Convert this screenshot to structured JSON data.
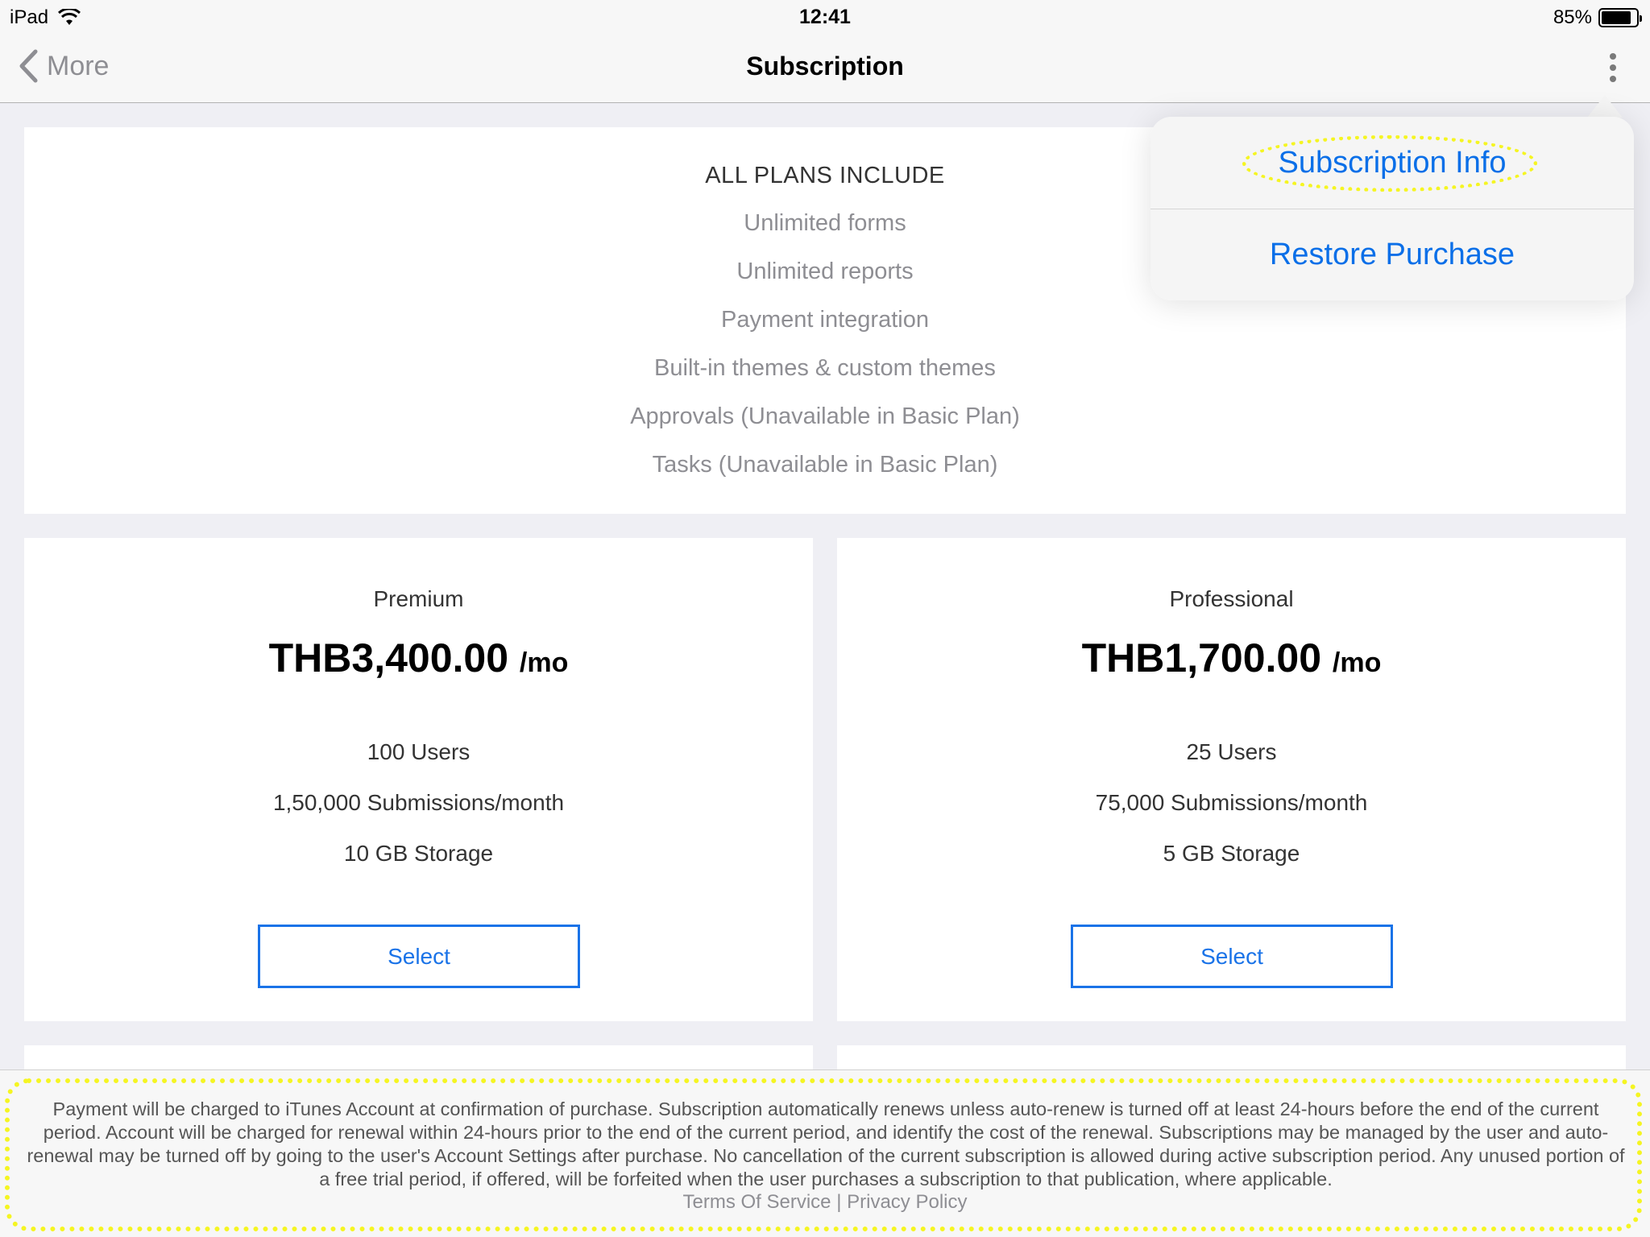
{
  "status_bar": {
    "device": "iPad",
    "time": "12:41",
    "battery": "85%",
    "battery_level": 0.85
  },
  "nav": {
    "back_label": "More",
    "title": "Subscription"
  },
  "popover": {
    "items": [
      "Subscription Info",
      "Restore Purchase"
    ]
  },
  "features": {
    "heading": "ALL PLANS INCLUDE",
    "items": [
      "Unlimited forms",
      "Unlimited reports",
      "Payment integration",
      "Built-in themes & custom themes",
      "Approvals (Unavailable in Basic Plan)",
      "Tasks (Unavailable in Basic Plan)"
    ]
  },
  "plans": [
    {
      "name": "Premium",
      "price": "THB3,400.00",
      "period": "/mo",
      "features": [
        "100 Users",
        "1,50,000 Submissions/month",
        "10 GB Storage"
      ],
      "button": "Select"
    },
    {
      "name": "Professional",
      "price": "THB1,700.00",
      "period": "/mo",
      "features": [
        "25 Users",
        "75,000 Submissions/month",
        "5 GB Storage"
      ],
      "button": "Select"
    }
  ],
  "footer": {
    "text": "Payment will be charged to iTunes Account at confirmation of purchase. Subscription automatically renews unless auto-renew is turned off at least 24-hours before the end of the current period. Account will be charged for renewal within 24-hours prior to the end of the current period, and identify the cost of the renewal. Subscriptions may be managed by the user and auto-renewal may be turned off by going to the user's Account Settings after purchase. No cancellation of the current subscription is allowed during active subscription period. Any unused portion of a free trial period, if offered, will be forfeited when the user purchases a subscription to that publication, where applicable.",
    "terms": "Terms Of Service",
    "separator": "|",
    "privacy": "Privacy Policy"
  },
  "colors": {
    "accent": "#0a6fe8",
    "highlight": "#f5f522",
    "background": "#efeff4"
  }
}
